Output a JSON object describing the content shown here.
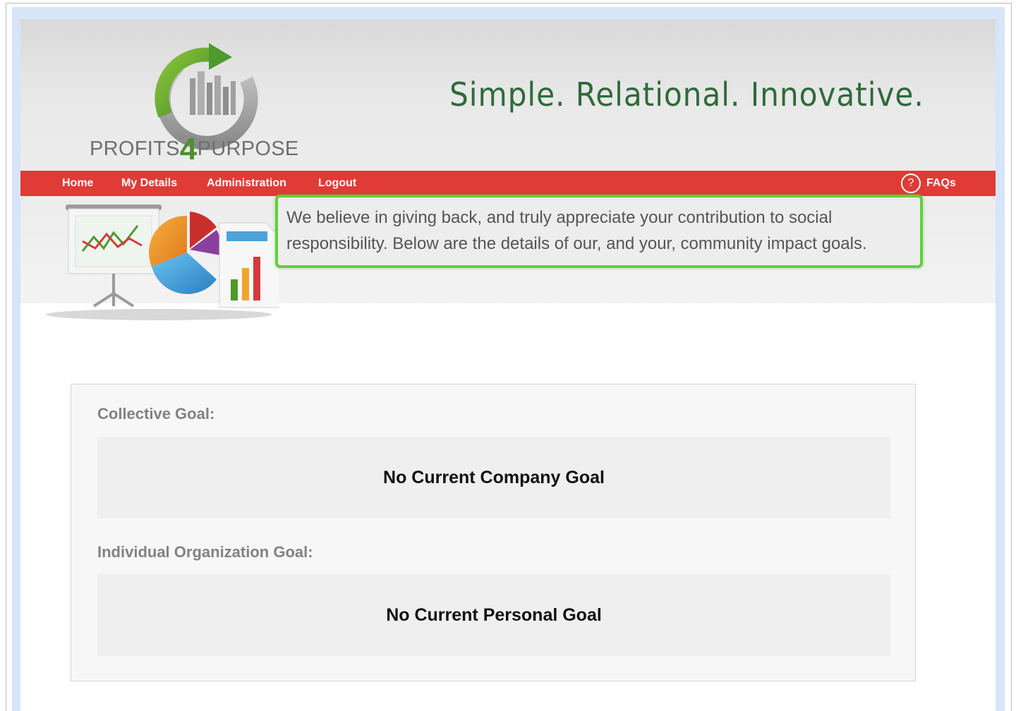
{
  "header": {
    "logo_text_left": "PROFITS",
    "logo_text_four": "4",
    "logo_text_right": "PURPOSE",
    "tagline": "Simple. Relational. Innovative."
  },
  "nav": {
    "items": [
      {
        "label": "Home"
      },
      {
        "label": "My Details"
      },
      {
        "label": "Administration"
      },
      {
        "label": "Logout"
      }
    ],
    "faq_icon": "?",
    "faq_label": "FAQs"
  },
  "banner": {
    "message": "We believe in giving back, and truly appreciate your contribution to social responsibility. Below are the details of our, and your, community impact goals."
  },
  "goals": {
    "collective_label": "Collective Goal:",
    "collective_value": "No Current Company Goal",
    "individual_label": "Individual Organization Goal:",
    "individual_value": "No Current Personal Goal"
  },
  "colors": {
    "nav_red": "#e03b36",
    "highlight_green": "#5fd13c",
    "tagline_green": "#2f6a3a"
  }
}
